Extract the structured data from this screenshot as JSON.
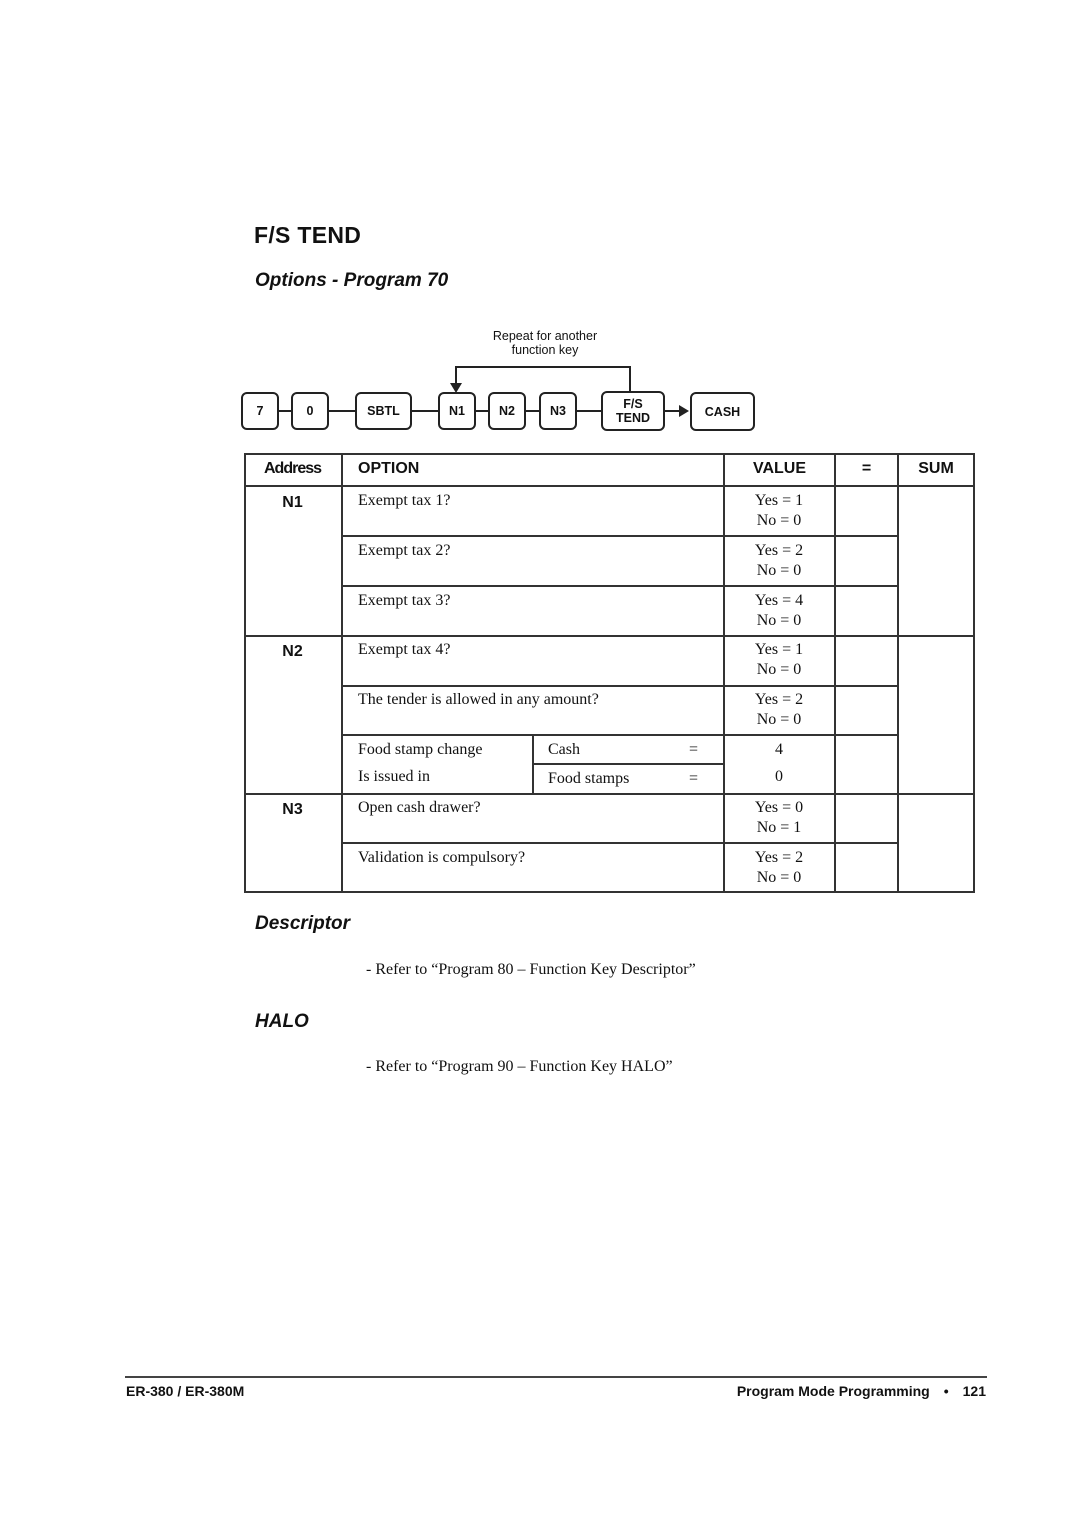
{
  "page": {
    "title": "F/S TEND",
    "subtitle": "Options - Program 70"
  },
  "diagram": {
    "repeat_note_line1": "Repeat for another",
    "repeat_note_line2": "function key",
    "keys": [
      {
        "label": "7"
      },
      {
        "label": "0"
      },
      {
        "label": "SBTL"
      },
      {
        "label": "N1"
      },
      {
        "label": "N2"
      },
      {
        "label": "N3"
      },
      {
        "label_line1": "F/S",
        "label_line2": "TEND"
      },
      {
        "label": "CASH"
      }
    ]
  },
  "table": {
    "headers": {
      "address": "Address",
      "option": "OPTION",
      "value": "VALUE",
      "equals": "=",
      "sum": "SUM"
    },
    "groups": [
      {
        "address": "N1"
      },
      {
        "address": "N2"
      },
      {
        "address": "N3"
      }
    ],
    "rows": [
      {
        "option": "Exempt tax 1?",
        "yes": "Yes = 1",
        "no": "No = 0"
      },
      {
        "option": "Exempt tax 2?",
        "yes": "Yes = 2",
        "no": "No = 0"
      },
      {
        "option": "Exempt tax 3?",
        "yes": "Yes = 4",
        "no": "No = 0"
      },
      {
        "option": "Exempt tax 4?",
        "yes": "Yes = 1",
        "no": "No = 0"
      },
      {
        "option": "The tender is allowed in any amount?",
        "yes": "Yes = 2",
        "no": "No = 0"
      },
      {
        "option_line1": "Food stamp change",
        "option_line2": "Is issued in",
        "choices": [
          {
            "label": "Cash",
            "eq": "=",
            "value": "4"
          },
          {
            "label": "Food stamps",
            "eq": "=",
            "value": "0"
          }
        ]
      },
      {
        "option": "Open cash drawer?",
        "yes": "Yes = 0",
        "no": "No = 1"
      },
      {
        "option": "Validation is compulsory?",
        "yes": "Yes = 2",
        "no": "No = 0"
      }
    ]
  },
  "descriptor": {
    "heading": "Descriptor",
    "text": "- Refer to “Program 80 – Function Key Descriptor”"
  },
  "halo": {
    "heading": "HALO",
    "text": "- Refer to “Program 90 – Function Key HALO”"
  },
  "footer": {
    "model": "ER-380 / ER-380M",
    "section": "Program Mode Programming",
    "bullet": "•",
    "page_number": "121"
  }
}
